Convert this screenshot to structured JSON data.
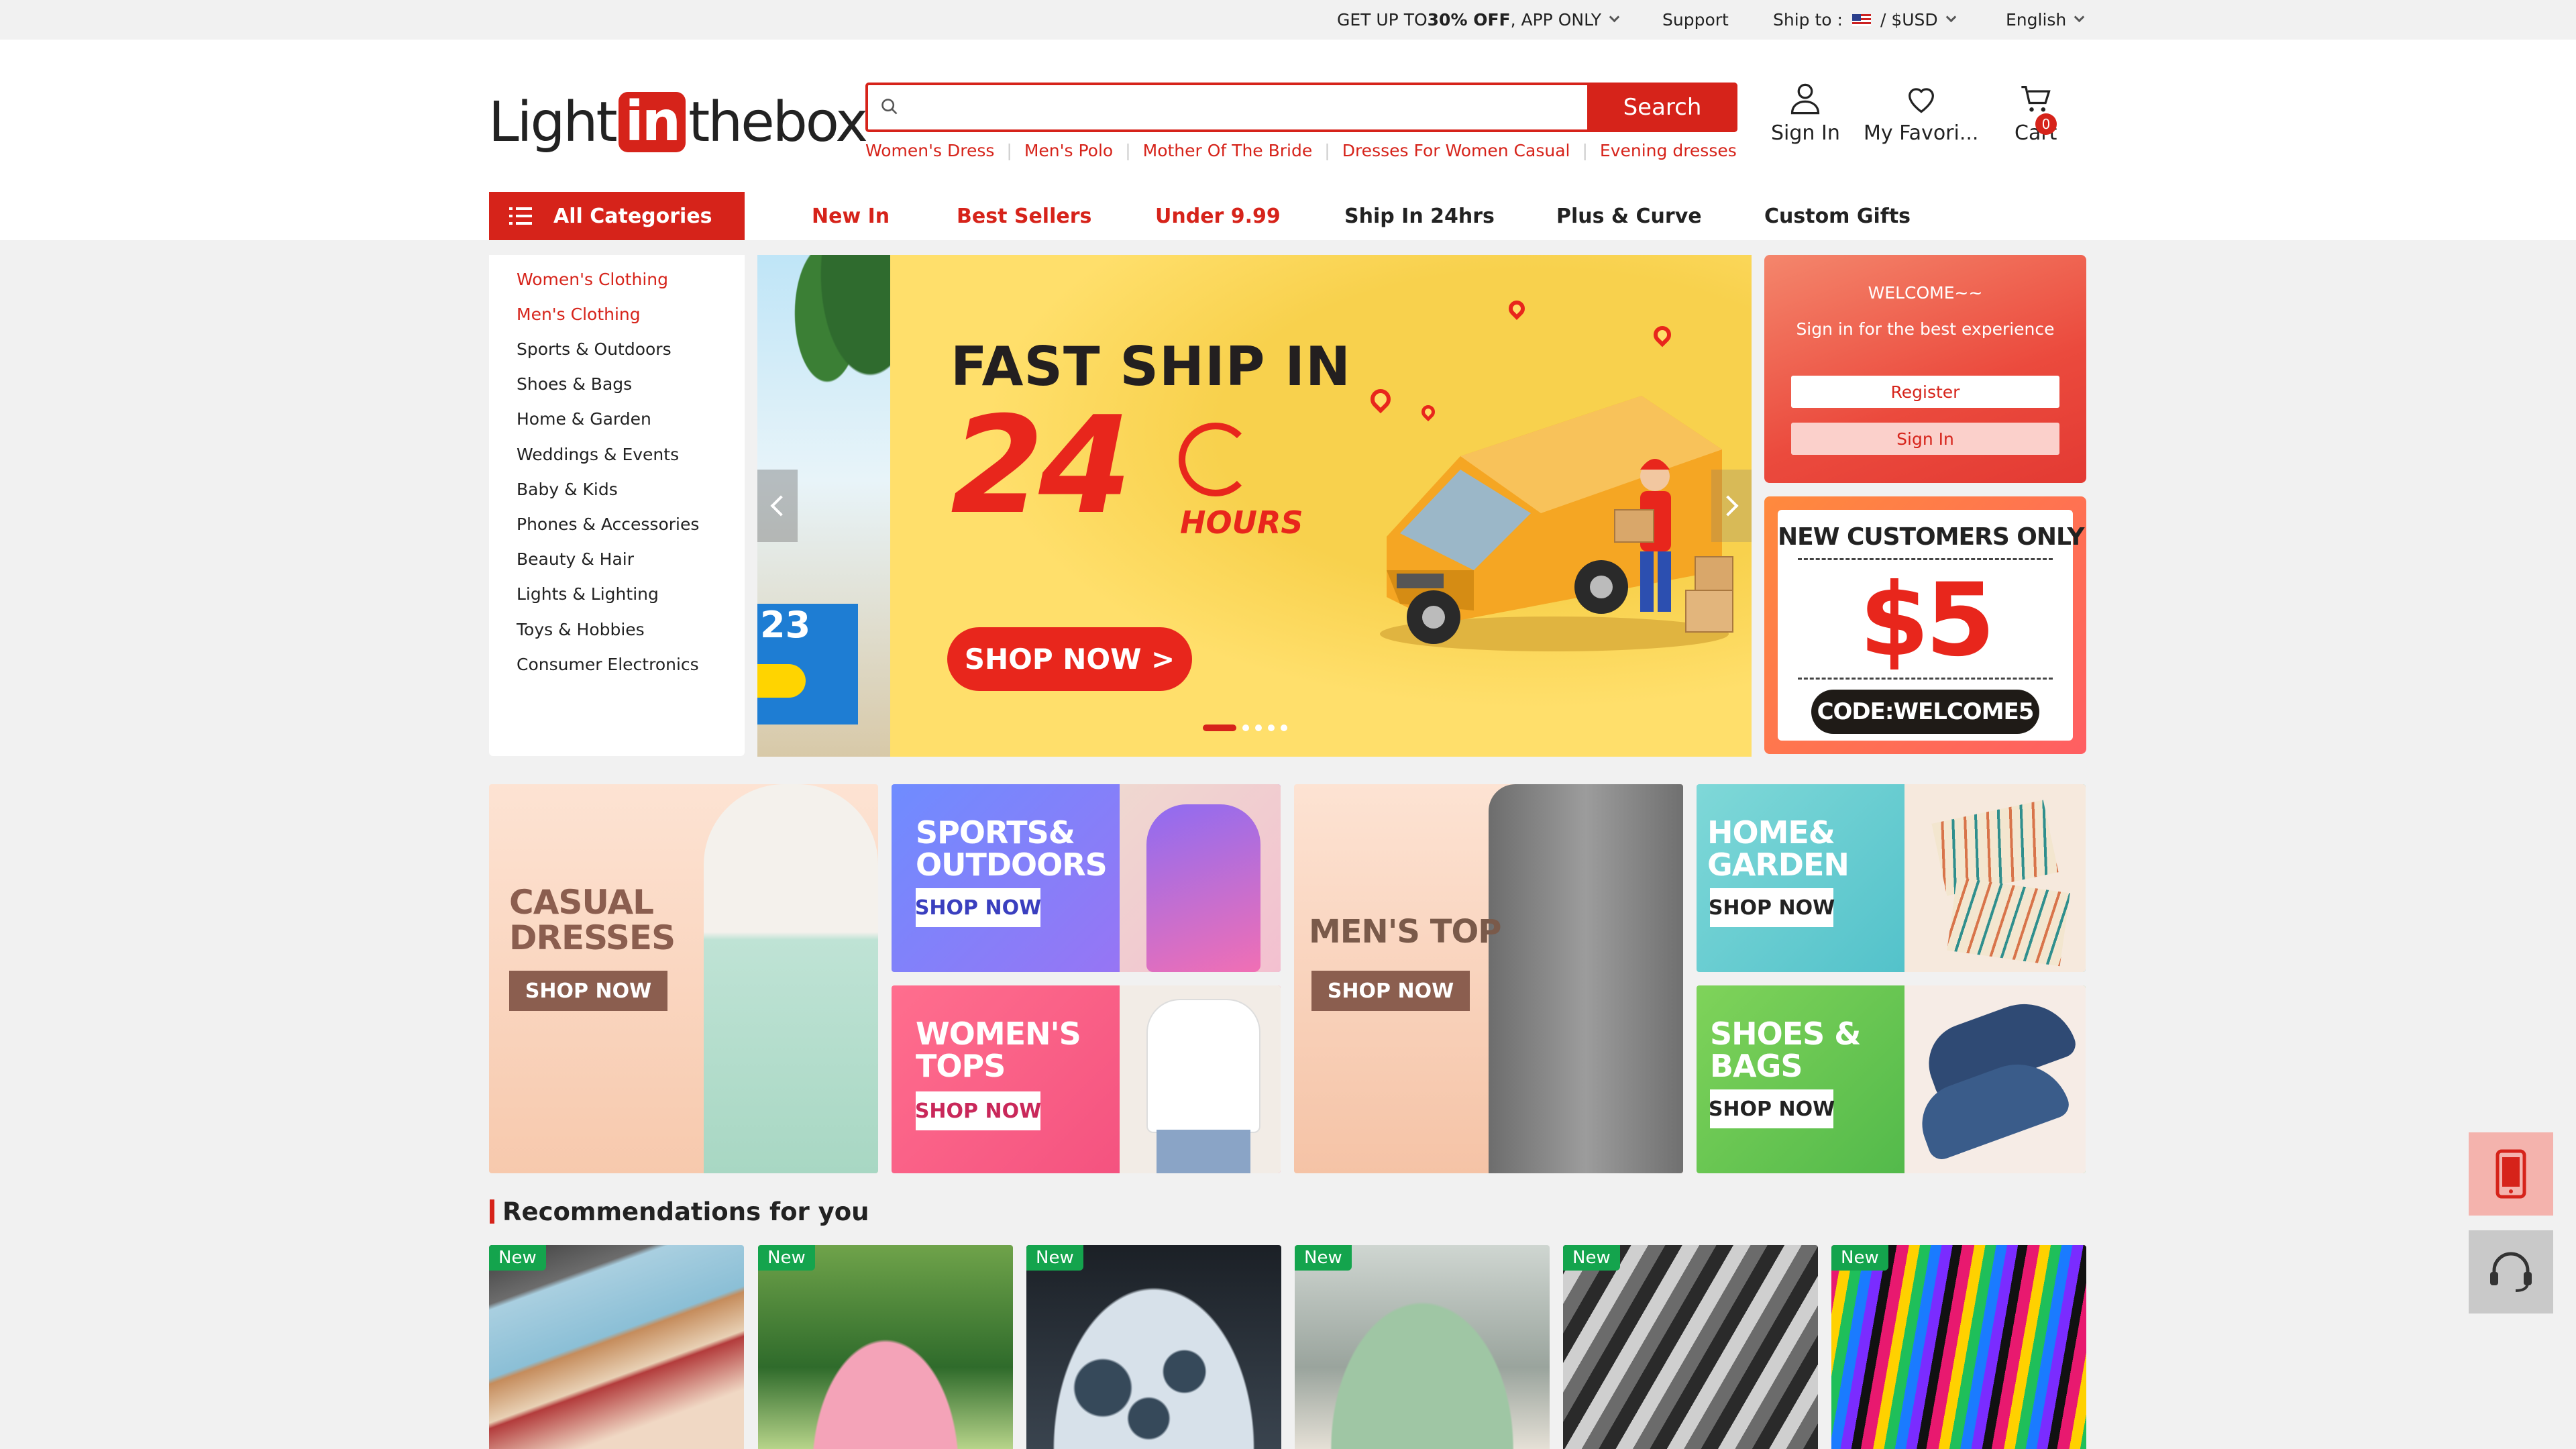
{
  "topbar": {
    "promo_prefix": "GET UP TO ",
    "promo_bold": "30% OFF",
    "promo_suffix": ", APP ONLY",
    "support": "Support",
    "ship_to": "Ship to :",
    "currency": "/  $USD",
    "language": "English"
  },
  "header": {
    "logo_light": "Light",
    "logo_in": "in",
    "logo_box": "thebox",
    "search_placeholder": "",
    "search_button": "Search",
    "hot_searches": [
      "Women's Dress",
      "Men's Polo",
      "Mother Of The Bride",
      "Dresses For Women Casual",
      "Evening dresses"
    ],
    "sign_in": "Sign In",
    "favorites": "My Favori...",
    "cart": "Cart",
    "cart_count": "0"
  },
  "nav": {
    "all_categories": "All Categories",
    "links": [
      {
        "label": "New In",
        "color": "#d6231a"
      },
      {
        "label": "Best Sellers",
        "color": "#d6231a"
      },
      {
        "label": "Under 9.99",
        "color": "#d6231a"
      },
      {
        "label": "Ship In 24hrs",
        "color": "#222222"
      },
      {
        "label": "Plus & Curve",
        "color": "#222222"
      },
      {
        "label": "Custom Gifts",
        "color": "#222222"
      }
    ]
  },
  "categories": [
    {
      "label": "Women's Clothing",
      "active": true
    },
    {
      "label": "Men's Clothing",
      "active": true
    },
    {
      "label": "Sports & Outdoors",
      "active": false
    },
    {
      "label": "Shoes & Bags",
      "active": false
    },
    {
      "label": "Home & Garden",
      "active": false
    },
    {
      "label": "Weddings & Events",
      "active": false
    },
    {
      "label": "Baby & Kids",
      "active": false
    },
    {
      "label": "Phones & Accessories",
      "active": false
    },
    {
      "label": "Beauty & Hair",
      "active": false
    },
    {
      "label": "Lights & Lighting",
      "active": false
    },
    {
      "label": "Toys & Hobbies",
      "active": false
    },
    {
      "label": "Consumer Electronics",
      "active": false
    }
  ],
  "hero": {
    "prev_peek_number": "23",
    "title": "FAST SHIP IN",
    "big_number": "24",
    "hours": "HOURS",
    "cta": "SHOP NOW >",
    "slide_count": 5,
    "active_slide": 1
  },
  "welcome": {
    "title": "WELCOME~~",
    "subtitle": "Sign in for the best experience",
    "register": "Register",
    "sign_in": "Sign In"
  },
  "coupon": {
    "title": "NEW CUSTOMERS ONLY",
    "amount": "$5",
    "code": "CODE:WELCOME5"
  },
  "promos": {
    "casual": {
      "label": "CASUAL\nDRESSES",
      "cta": "SHOP NOW"
    },
    "sports": {
      "label": "SPORTS&\nOUTDOORS",
      "cta": "SHOP NOW"
    },
    "mens": {
      "label": "MEN'S TOP",
      "cta": "SHOP NOW"
    },
    "home": {
      "label": "HOME&\nGARDEN",
      "cta": "SHOP NOW"
    },
    "womens": {
      "label": "WOMEN'S\nTOPS",
      "cta": "SHOP NOW"
    },
    "shoes": {
      "label": "SHOES &\nBAGS",
      "cta": "SHOP NOW"
    }
  },
  "recommendations": {
    "title": "Recommendations for you",
    "badge": "New",
    "products": [
      {
        "kind": "notebooks"
      },
      {
        "kind": "pink-polo-dress"
      },
      {
        "kind": "mesh-3d-tee"
      },
      {
        "kind": "green-floral-set"
      },
      {
        "kind": "gray-swirl-polo"
      },
      {
        "kind": "rainbow-stripe-shirt"
      }
    ]
  },
  "colors": {
    "brand_red": "#d6231a",
    "new_badge": "#14a44d",
    "page_bg": "#f1f1f1"
  }
}
